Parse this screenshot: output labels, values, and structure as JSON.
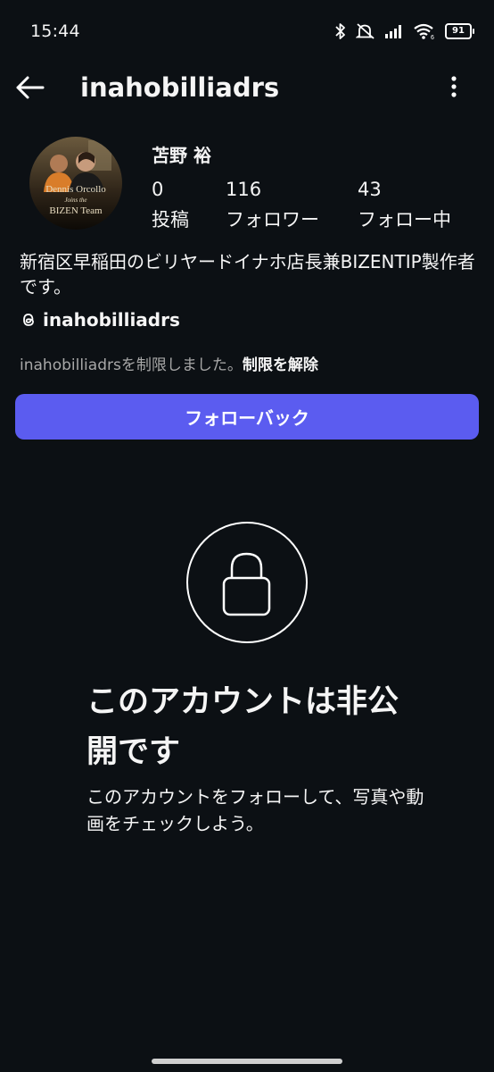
{
  "status_bar": {
    "time": "15:44",
    "battery": "91",
    "icons": [
      "bluetooth-icon",
      "mute-icon",
      "signal-icon",
      "wifi-icon",
      "battery-icon"
    ]
  },
  "header": {
    "username": "inahobilliadrs",
    "back_icon": "back-arrow-icon",
    "menu_icon": "more-vertical-icon"
  },
  "profile": {
    "display_name": "苫野 裕",
    "avatar_caption": [
      "Dennis Orcollo",
      "Joins the",
      "BIZEN Team"
    ],
    "stats": [
      {
        "value": "0",
        "label": "投稿"
      },
      {
        "value": "116",
        "label": "フォロワー"
      },
      {
        "value": "43",
        "label": "フォロー中"
      }
    ],
    "bio": "新宿区早稲田のビリヤードイナホ店長兼BIZENTIP製作者です。",
    "threads_handle": "inahobilliadrs",
    "restricted_text": "inahobilliadrsを制限しました。",
    "unrestrict_label": "制限を解除",
    "follow_back_label": "フォローバック"
  },
  "private_notice": {
    "title": "このアカウントは非公開です",
    "description": "このアカウントをフォローして、写真や動画をチェックしよう。"
  },
  "colors": {
    "background": "#0c1014",
    "button": "#5b5cf0",
    "muted_text": "#a8a8a8"
  }
}
